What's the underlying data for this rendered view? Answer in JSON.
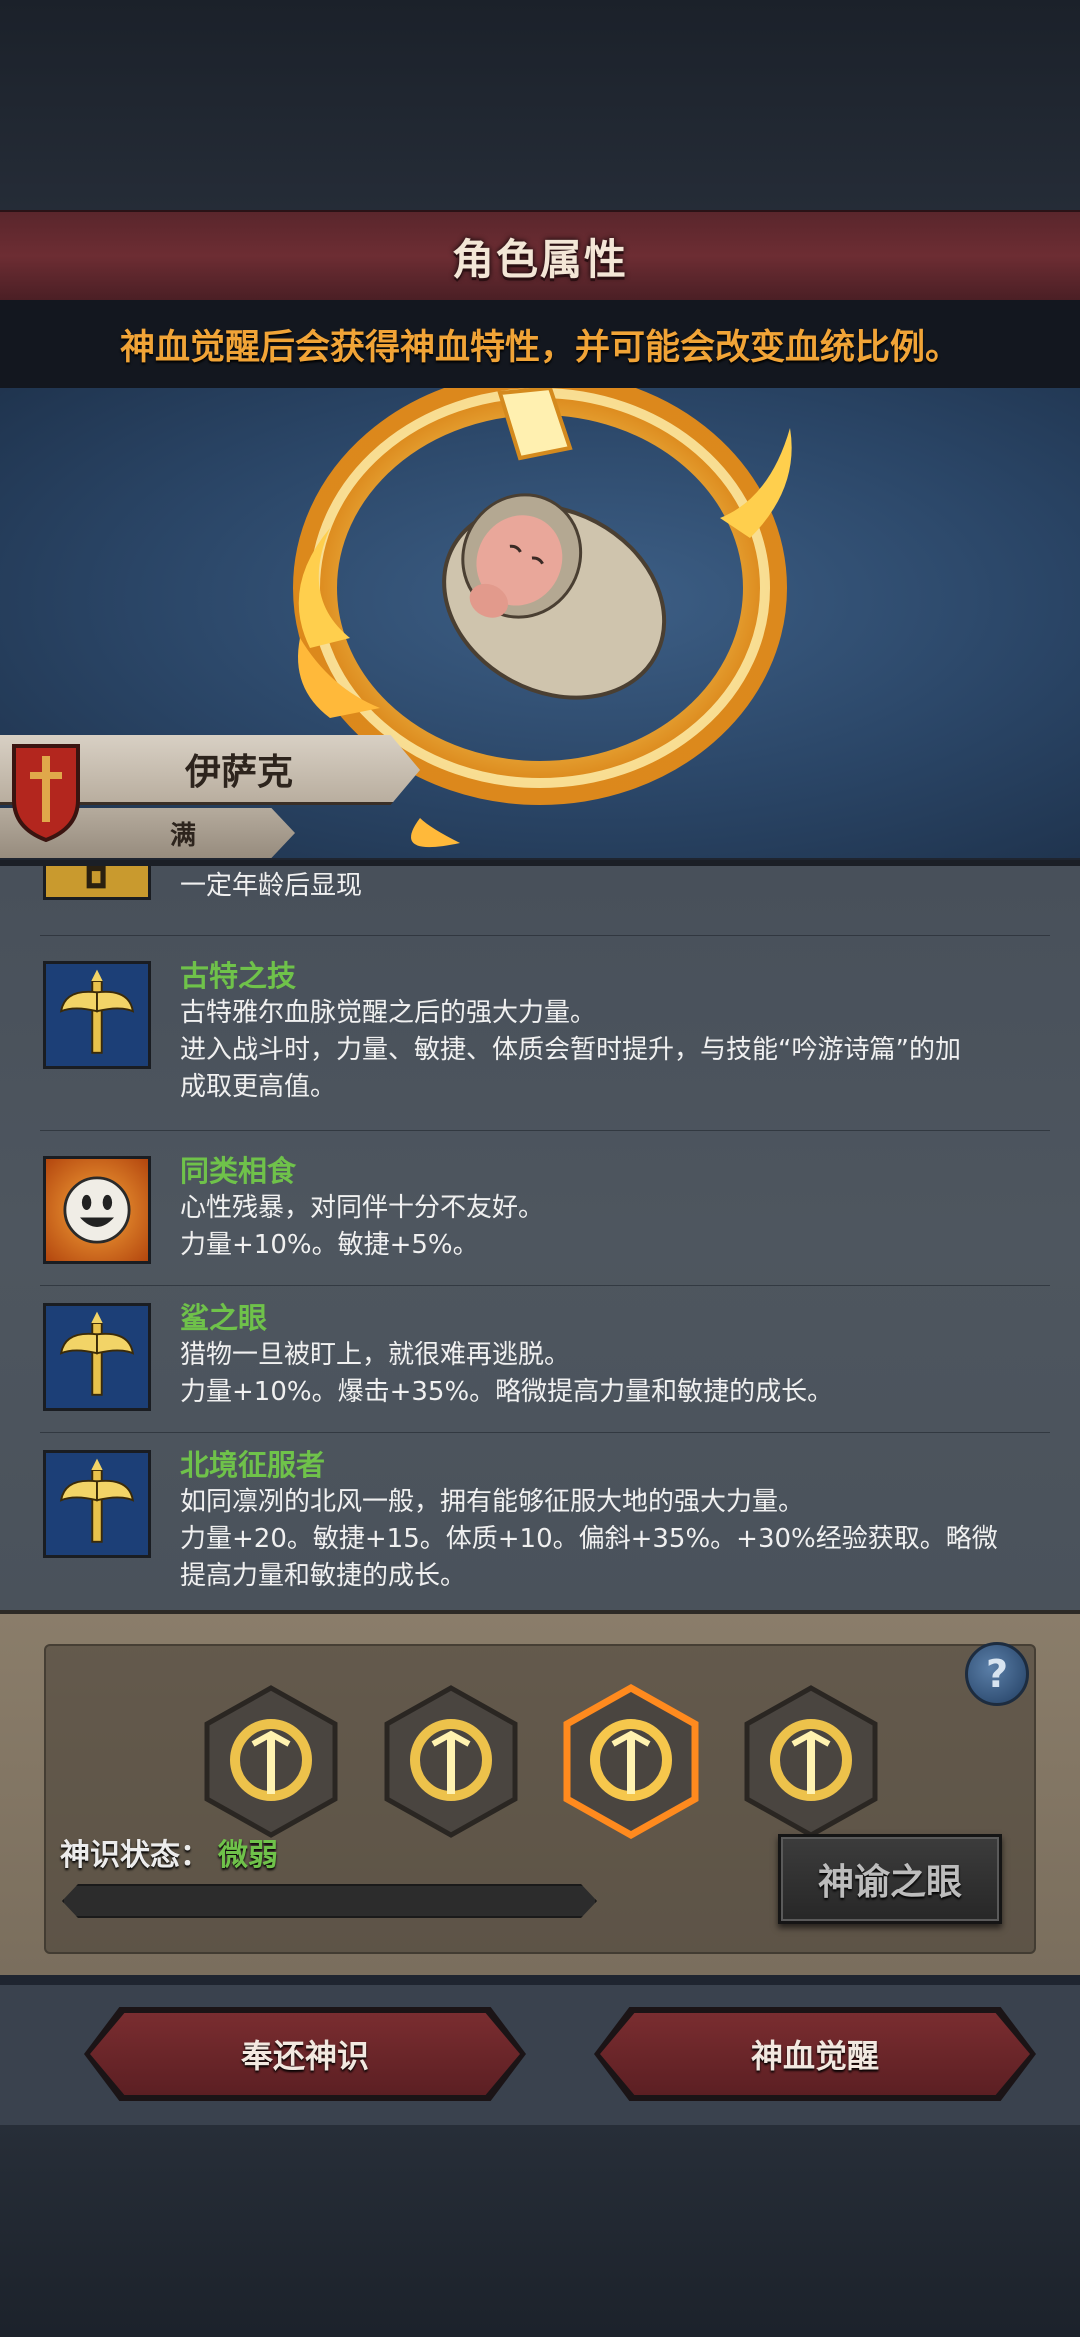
{
  "header": {
    "title": "角色属性",
    "notice": "神血觉醒后会获得神血特性，并可能会改变血统比例。"
  },
  "character": {
    "name": "伊萨克",
    "sub_label": "满",
    "portrait_icon": "swaddled-baby-in-fire-ring"
  },
  "traits": [
    {
      "icon": "locked-trait-icon",
      "name": "",
      "lines": [
        "一定年龄后显现"
      ]
    },
    {
      "icon": "golden-axe-icon",
      "name": "古特之技",
      "lines": [
        "古特雅尔血脉觉醒之后的强大力量。",
        "进入战斗时，力量、敏捷、体质会暂时提升，与技能“吟游诗篇”的加",
        "成取更高值。"
      ]
    },
    {
      "icon": "smiley-face-icon",
      "name": "同类相食",
      "lines": [
        "心性残暴，对同伴十分不友好。",
        "力量+10%。敏捷+5%。"
      ]
    },
    {
      "icon": "golden-axe-icon",
      "name": "鲨之眼",
      "lines": [
        "猎物一旦被盯上，就很难再逃脱。",
        "力量+10%。爆击+35%。略微提高力量和敏捷的成长。"
      ]
    },
    {
      "icon": "golden-axe-icon",
      "name": "北境征服者",
      "lines": [
        "如同凛冽的北风一般，拥有能够征服大地的强大力量。",
        "力量+20。敏捷+15。体质+10。偏斜+35%。+30%经验获取。略微",
        "提高力量和敏捷的成长。"
      ]
    }
  ],
  "divine": {
    "slots": [
      {
        "icon": "flame-trident-icon",
        "selected": false
      },
      {
        "icon": "flame-trident-icon",
        "selected": false
      },
      {
        "icon": "flame-trident-icon",
        "selected": true
      },
      {
        "icon": "flame-trident-icon",
        "selected": false
      }
    ],
    "help_label": "?",
    "status_label": "神识状态：",
    "status_value": "微弱",
    "progress": 0.0,
    "oracle_button": "神谕之眼"
  },
  "buttons": {
    "return_label": "奉还神识",
    "awaken_label": "神血觉醒"
  },
  "colors": {
    "accent_orange": "#f1a437",
    "trait_green": "#6fc24a",
    "title_red": "#6d2d33"
  }
}
